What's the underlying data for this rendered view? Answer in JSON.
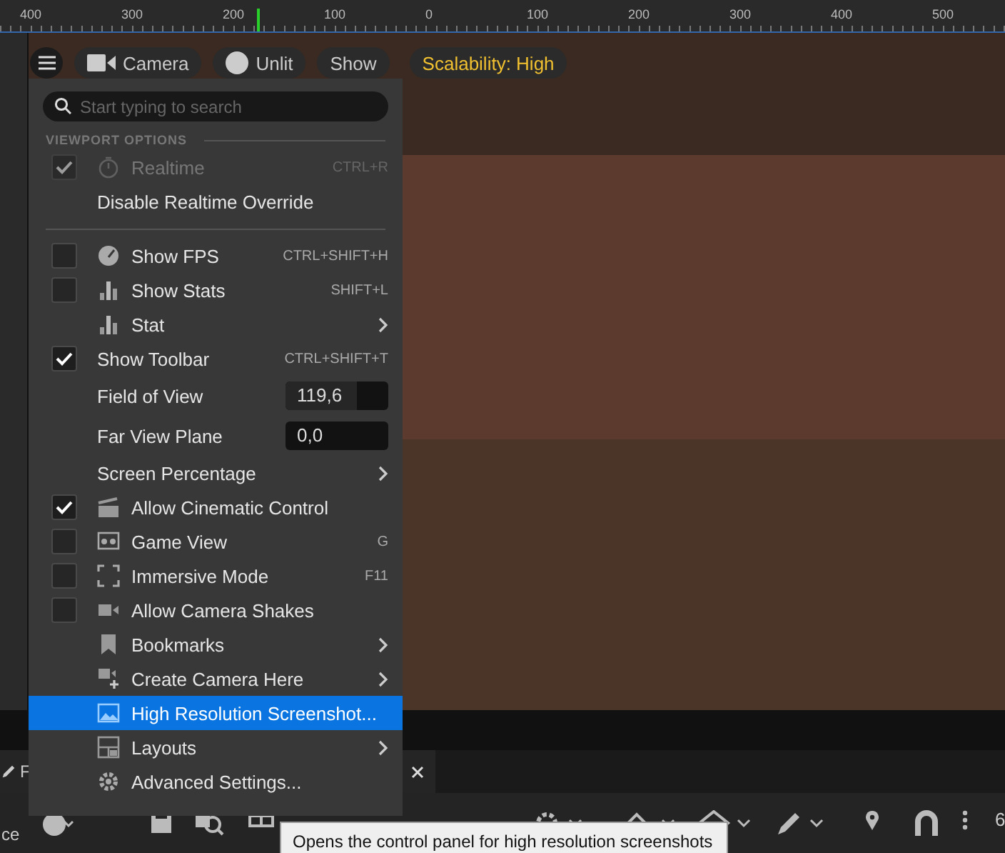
{
  "ruler": {
    "labels": [
      "400",
      "300",
      "200",
      "100",
      "0",
      "100",
      "200",
      "300",
      "400",
      "500"
    ]
  },
  "viewport_toolbar": {
    "buttons": [
      {
        "kind": "camera",
        "label": "Camera"
      },
      {
        "kind": "unlit",
        "label": "Unlit"
      },
      {
        "kind": "plain",
        "label": "Show"
      },
      {
        "kind": "warning",
        "label": "Scalability: High"
      }
    ]
  },
  "menu": {
    "search": {
      "placeholder": "Start typing to search"
    },
    "sections": [
      {
        "header": "VIEWPORT OPTIONS",
        "items": [
          {
            "kind": "check",
            "label": "Realtime",
            "checked": true,
            "disabled": true,
            "shortcut": "CTRL+R",
            "submenu": false,
            "selected": false
          },
          {
            "kind": "plain",
            "label": "Disable Realtime Override",
            "disabled": false,
            "submenu": false,
            "selected": false
          }
        ]
      },
      {
        "items": [
          {
            "kind": "check",
            "label": "Show FPS",
            "checked": false,
            "disabled": false,
            "shortcut": "CTRL+SHIFT+H",
            "submenu": false,
            "selected": false
          },
          {
            "kind": "check",
            "label": "Show Stats",
            "checked": false,
            "disabled": false,
            "shortcut": "SHIFT+L",
            "submenu": false,
            "selected": false
          },
          {
            "kind": "plain",
            "label": "Stat",
            "disabled": false,
            "submenu": true,
            "selected": false
          },
          {
            "kind": "check",
            "label": "Show Toolbar",
            "checked": true,
            "disabled": false,
            "shortcut": "CTRL+SHIFT+T",
            "submenu": false,
            "selected": false
          },
          {
            "kind": "field",
            "label": "Field of View",
            "value": "119,6",
            "level": 0.7,
            "disabled": false,
            "submenu": false,
            "selected": false
          },
          {
            "kind": "field",
            "label": "Far View Plane",
            "value": "0,0",
            "level": 0,
            "disabled": false,
            "submenu": false,
            "selected": false
          },
          {
            "kind": "plain",
            "label": "Screen Percentage",
            "disabled": false,
            "submenu": true,
            "selected": false
          },
          {
            "kind": "check",
            "label": "Allow Cinematic Control",
            "checked": true,
            "disabled": false,
            "submenu": false,
            "selected": false
          },
          {
            "kind": "check",
            "label": "Game View",
            "checked": false,
            "disabled": false,
            "shortcut": "G",
            "submenu": false,
            "selected": false
          },
          {
            "kind": "check",
            "label": "Immersive Mode",
            "checked": false,
            "disabled": false,
            "shortcut": "F11",
            "submenu": false,
            "selected": false
          },
          {
            "kind": "check",
            "label": "Allow Camera Shakes",
            "checked": false,
            "disabled": false,
            "submenu": false,
            "selected": false
          },
          {
            "kind": "plain",
            "label": "Bookmarks",
            "disabled": false,
            "submenu": true,
            "selected": false
          },
          {
            "kind": "plain",
            "label": "Create Camera Here",
            "disabled": false,
            "submenu": true,
            "selected": false
          },
          {
            "kind": "plain",
            "label": "High Resolution Screenshot...",
            "disabled": false,
            "submenu": false,
            "selected": true
          },
          {
            "kind": "plain",
            "label": "Layouts",
            "disabled": false,
            "submenu": true,
            "selected": false
          },
          {
            "kind": "plain",
            "label": "Advanced Settings...",
            "disabled": false,
            "submenu": false,
            "selected": false
          }
        ]
      }
    ]
  },
  "bottom_panel": {
    "tab": {
      "label": "F"
    },
    "side_label": "ce",
    "overflow_text": "6"
  },
  "tooltip": "Opens the control panel for high resolution screenshots"
}
